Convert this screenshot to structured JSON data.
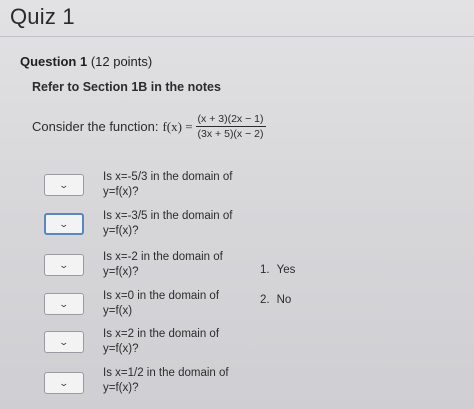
{
  "quiz": {
    "title": "Quiz 1"
  },
  "question": {
    "label": "Question 1",
    "points": "(12 points)",
    "refer_text": "Refer to Section 1B in the notes",
    "consider_text": "Consider the function:",
    "function_lhs": "f(x) =",
    "numerator": "(x + 3)(2x − 1)",
    "denominator": "(3x + 5)(x − 2)"
  },
  "items": [
    {
      "line1": "Is x=-5/3 in the domain of",
      "line2": "y=f(x)?"
    },
    {
      "line1": "Is x=-3/5 in the domain of",
      "line2": "y=f(x)?"
    },
    {
      "line1": "Is x=-2 in the domain of",
      "line2": "y=f(x)?"
    },
    {
      "line1": "Is x=0 in the domain of",
      "line2": "y=f(x)"
    },
    {
      "line1": "Is x=2 in the domain of",
      "line2": "y=f(x)?"
    },
    {
      "line1": "Is x=1/2 in the domain of",
      "line2": "y=f(x)?"
    }
  ],
  "answers": [
    {
      "number": "1.",
      "label": "Yes"
    },
    {
      "number": "2.",
      "label": "No"
    }
  ],
  "icons": {
    "dropdown": "chevron-down-icon"
  },
  "colors": {
    "focus_border": "#5a86c4",
    "select_border": "#9a9aa0"
  }
}
